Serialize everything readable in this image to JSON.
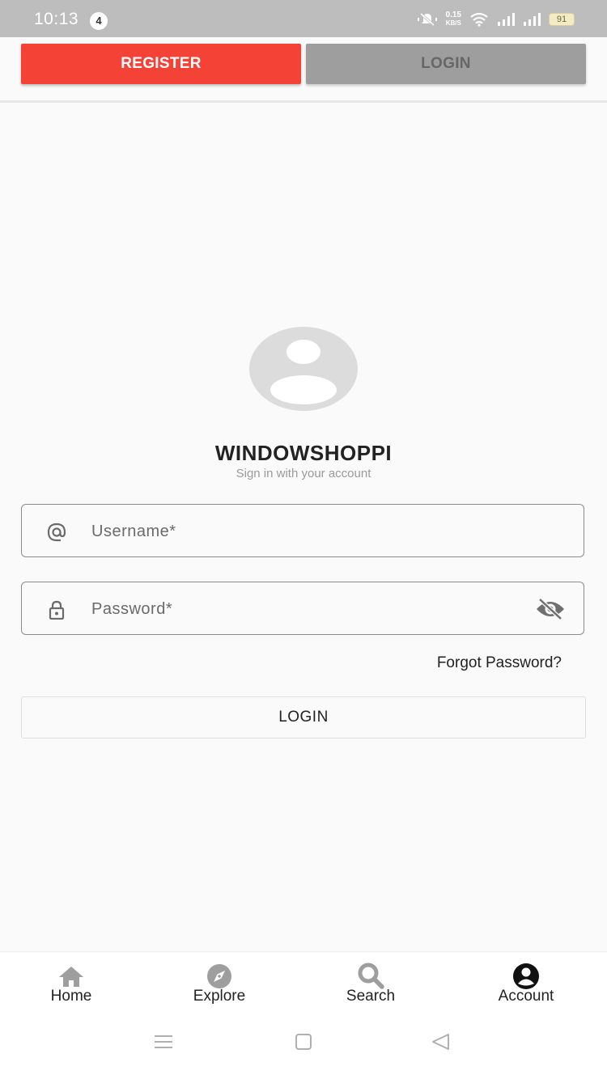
{
  "status_bar": {
    "time": "10:13",
    "notification_count": "4",
    "speed_value": "0.15",
    "speed_unit": "KB/S",
    "battery": "91"
  },
  "top_tabs": {
    "register_label": "REGISTER",
    "login_label": "LOGIN",
    "active_color": "#f44336",
    "inactive_color": "#9e9e9e"
  },
  "header": {
    "brand": "WINDOWSHOPPI",
    "tagline": "Sign in with your account"
  },
  "form": {
    "username_placeholder": "Username*",
    "username_icon": "at-icon",
    "password_placeholder": "Password*",
    "password_icon": "lock-icon",
    "visibility_icon": "eye-off-icon",
    "forgot_label": "Forgot Password?",
    "submit_label": "LOGIN"
  },
  "bottom_nav": {
    "items": [
      {
        "label": "Home",
        "icon": "home-icon"
      },
      {
        "label": "Explore",
        "icon": "compass-icon"
      },
      {
        "label": "Search",
        "icon": "search-icon"
      },
      {
        "label": "Account",
        "icon": "account-circle-icon"
      }
    ],
    "active_index": 3
  },
  "system_nav": {
    "icons": [
      "menu-icon",
      "square-icon",
      "back-triangle-icon"
    ]
  }
}
